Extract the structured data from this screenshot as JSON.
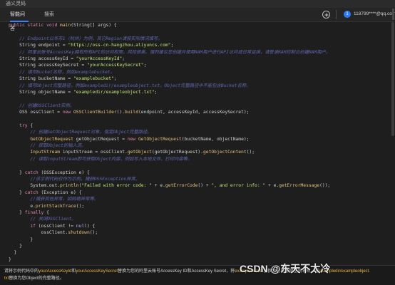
{
  "window": {
    "title": "通义灵码"
  },
  "tabs": [
    {
      "label": "智能问答",
      "active": true
    },
    {
      "label": "搜索",
      "active": false
    }
  ],
  "header": {
    "badge": "1",
    "account": "118799****@qq.com"
  },
  "code_lines": [
    [
      [
        "k",
        "public static void "
      ],
      [
        "f",
        "main"
      ],
      [
        "p",
        "(String[] args) {"
      ]
    ],
    [
      [
        "p",
        ""
      ]
    ],
    [
      [
        "c",
        "    // Endpoint以华东1（杭州）为例，其它Region请按实际情况填写。"
      ]
    ],
    [
      [
        "p",
        "    String endpoint = "
      ],
      [
        "s",
        "\"https://oss-cn-hangzhou.aliyuncs.com\""
      ],
      [
        "p",
        ";"
      ]
    ],
    [
      [
        "c",
        "    // 阿里云账号AccessKey拥有所有API的访问权限，风险很高。强烈建议您创建并使用RAM用户进行API访问或日常运维，请登录RAM控制台创建RAM用户。"
      ]
    ],
    [
      [
        "p",
        "    String accessKeyId = "
      ],
      [
        "s",
        "\"yourAccessKeyId\""
      ],
      [
        "p",
        ";"
      ]
    ],
    [
      [
        "p",
        "    String accessKeySecret = "
      ],
      [
        "s",
        "\"yourAccessKeySecret\""
      ],
      [
        "p",
        ";"
      ]
    ],
    [
      [
        "c",
        "    // 填写Bucket名称，例如examplebucket。"
      ]
    ],
    [
      [
        "p",
        "    String bucketName = "
      ],
      [
        "s",
        "\"examplebucket\""
      ],
      [
        "p",
        ";"
      ]
    ],
    [
      [
        "c",
        "    // 填写Object完整路径，例如exampledir/exampleobject.txt。Object完整路径中不能包含Bucket名称。"
      ]
    ],
    [
      [
        "p",
        "    String objectName = "
      ],
      [
        "s",
        "\"exampledir/exampleobject.txt\""
      ],
      [
        "p",
        ";"
      ]
    ],
    [
      [
        "p",
        ""
      ]
    ],
    [
      [
        "c",
        "    // 创建OSSClient实例。"
      ]
    ],
    [
      [
        "p",
        "    OSS ossClient = "
      ],
      [
        "k",
        "new "
      ],
      [
        "f",
        "OSSClientBuilder"
      ],
      [
        "p",
        "()."
      ],
      [
        "f",
        "build"
      ],
      [
        "p",
        "(endpoint, accessKeyId, accessKeySecret);"
      ]
    ],
    [
      [
        "p",
        ""
      ]
    ],
    [
      [
        "k",
        "    try "
      ],
      [
        "p",
        "{"
      ]
    ],
    [
      [
        "c",
        "        // 创建GetObjectRequest对象，指定Object完整路径。"
      ]
    ],
    [
      [
        "p",
        "        "
      ],
      [
        "f",
        "GetObjectRequest"
      ],
      [
        "p",
        " getObjectRequest = "
      ],
      [
        "k",
        "new "
      ],
      [
        "f",
        "GetObjectRequest"
      ],
      [
        "p",
        "(bucketName, objectName);"
      ]
    ],
    [
      [
        "c",
        "        // 获取Object的输入流。"
      ]
    ],
    [
      [
        "p",
        "        "
      ],
      [
        "f",
        "InputStream"
      ],
      [
        "p",
        " inputStream = ossClient."
      ],
      [
        "f",
        "getObject"
      ],
      [
        "p",
        "(getObjectRequest)."
      ],
      [
        "f",
        "getObjectContent"
      ],
      [
        "p",
        "();"
      ]
    ],
    [
      [
        "c",
        "        // 读取inputStream即可获取Object内容，例如写入本地文件、打印内容等。"
      ]
    ],
    [
      [
        "p",
        ""
      ]
    ],
    [
      [
        "p",
        "    } "
      ],
      [
        "k",
        "catch "
      ],
      [
        "p",
        "(OSSException e) {"
      ]
    ],
    [
      [
        "c",
        "        //该示例代码仅作为示例，捕获OSSException异常。"
      ]
    ],
    [
      [
        "p",
        "        System.out."
      ],
      [
        "f",
        "println"
      ],
      [
        "p",
        "("
      ],
      [
        "s",
        "\"Failed with error code: \""
      ],
      [
        "p",
        " + e."
      ],
      [
        "f",
        "getErrorCode"
      ],
      [
        "p",
        "() + "
      ],
      [
        "s",
        "\", and error info: \""
      ],
      [
        "p",
        " + e."
      ],
      [
        "f",
        "getErrorMessage"
      ],
      [
        "p",
        "());"
      ]
    ],
    [
      [
        "p",
        "    } "
      ],
      [
        "k",
        "catch "
      ],
      [
        "p",
        "(Exception e) {"
      ]
    ],
    [
      [
        "c",
        "        //捕获其他异常，如网络异常等。"
      ]
    ],
    [
      [
        "p",
        "        e."
      ],
      [
        "f",
        "printStackTrace"
      ],
      [
        "p",
        "();"
      ]
    ],
    [
      [
        "p",
        "    } "
      ],
      [
        "k",
        "finally "
      ],
      [
        "p",
        "{"
      ]
    ],
    [
      [
        "c",
        "        // 关闭OSSClient。"
      ]
    ],
    [
      [
        "k",
        "        if "
      ],
      [
        "p",
        "(ossClient != "
      ],
      [
        "n",
        "null"
      ],
      [
        "p",
        ") {"
      ]
    ],
    [
      [
        "p",
        "            ossClient."
      ],
      [
        "f",
        "shutdown"
      ],
      [
        "p",
        "();"
      ]
    ],
    [
      [
        "p",
        "        }"
      ]
    ],
    [
      [
        "p",
        "    }"
      ]
    ],
    [
      [
        "p",
        "  }"
      ]
    ],
    [
      [
        "p",
        "}"
      ]
    ]
  ],
  "footer": {
    "line1": [
      [
        "t",
        "请将示例代码中的"
      ],
      [
        "hl",
        "yourAccessKeyId"
      ],
      [
        "t",
        "和"
      ],
      [
        "hl",
        "yourAccessKeySecret"
      ],
      [
        "t",
        "替换为您的阿里云账号AccessKey ID和AccessKey Secret，将"
      ],
      [
        "hl",
        "examplebucket"
      ],
      [
        "t",
        "替换为您的存储空间名称，将"
      ],
      [
        "hl",
        "exampledir/exampleobject."
      ]
    ],
    "line2": [
      [
        "hl",
        "txt"
      ],
      [
        "t",
        "替换为您Object的完整路径。"
      ]
    ]
  },
  "watermark": "CSDN @东天不太冷"
}
